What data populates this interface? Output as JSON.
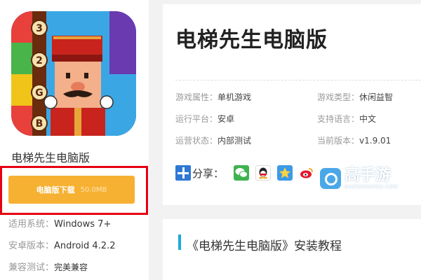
{
  "app": {
    "name": "电梯先生电脑版",
    "icon": "elevator-bellhop-app-icon",
    "icon_numbers": [
      "3",
      "2",
      "G",
      "B"
    ]
  },
  "download": {
    "label": "电脑版下载",
    "size": "50.0MB",
    "color": "#f6b133",
    "highlight_color": "#e60012"
  },
  "specs": [
    {
      "key": "适用系统：",
      "value": "Windows 7+"
    },
    {
      "key": "安卓版本：",
      "value": "Android 4.2.2"
    },
    {
      "key": "兼容测试：",
      "value": "完美兼容"
    }
  ],
  "title": "电梯先生电脑版",
  "attributes": [
    {
      "key": "游戏属性：",
      "value": "单机游戏"
    },
    {
      "key": "游戏类型：",
      "value": "休闲益智"
    },
    {
      "key": "运行平台：",
      "value": "安卓"
    },
    {
      "key": "支持语言：",
      "value": "中文"
    },
    {
      "key": "运营状态：",
      "value": "内部测试"
    },
    {
      "key": "当前版本：",
      "value": "v1.9.01"
    }
  ],
  "share": {
    "label": "分享：",
    "targets": [
      "wechat-icon",
      "qq-icon",
      "qzone-icon",
      "weibo-icon"
    ]
  },
  "watermark": {
    "title": "高手游",
    "subtitle": "GAOSHOUYOU.COM"
  },
  "tutorial": {
    "title": "《电梯先生电脑版》安装教程",
    "accent": "#1ea9d8"
  }
}
